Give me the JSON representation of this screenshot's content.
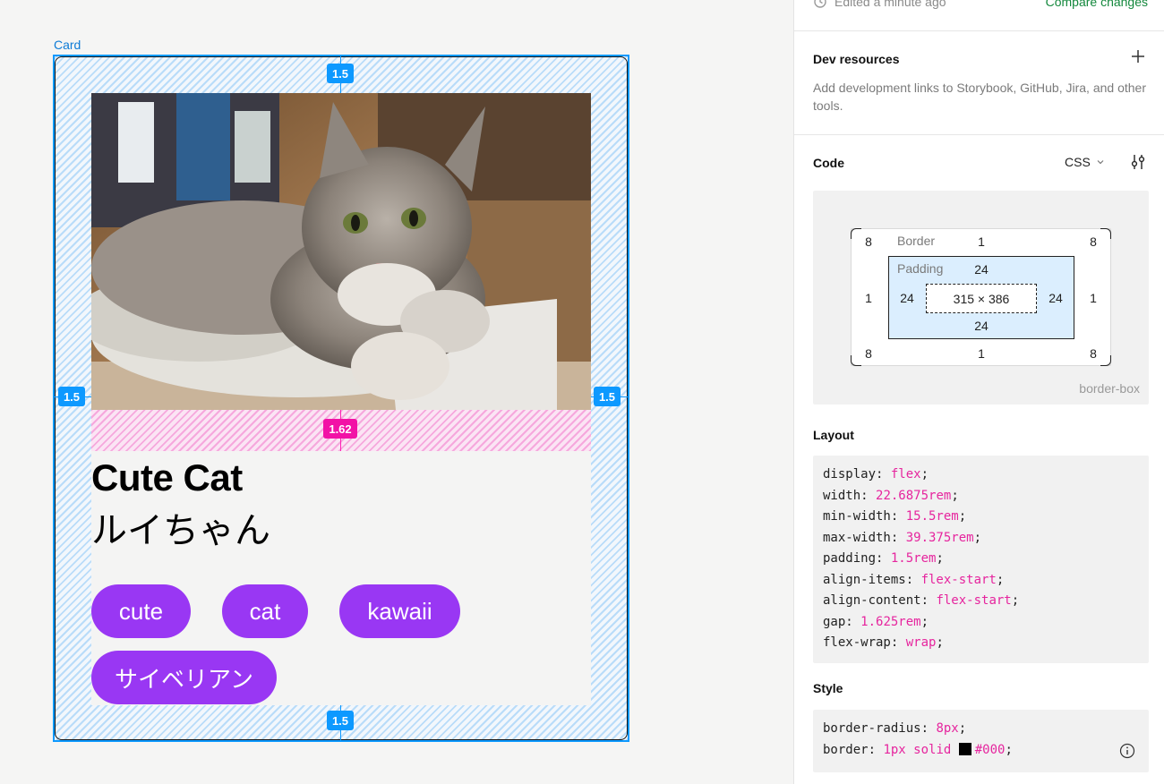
{
  "canvas": {
    "frame_label": "Card",
    "card": {
      "title": "Cute Cat",
      "subtitle": "ルイちゃん",
      "tags": [
        "cute",
        "cat",
        "kawaii",
        "サイベリアン"
      ]
    },
    "measurements": {
      "padding_top": "1.5",
      "padding_left": "1.5",
      "padding_right": "1.5",
      "padding_bottom": "1.5",
      "gap": "1.62"
    }
  },
  "panel": {
    "history": {
      "edited_text": "Edited a minute ago",
      "compare_link": "Compare changes"
    },
    "dev_resources": {
      "title": "Dev resources",
      "description": "Add development links to Storybook, GitHub, Jira, and other tools."
    },
    "code": {
      "title": "Code",
      "language": "CSS",
      "box_model": {
        "border_label": "Border",
        "padding_label": "Padding",
        "radius_tl": "8",
        "radius_tr": "8",
        "radius_bl": "8",
        "radius_br": "8",
        "border_top": "1",
        "border_bottom": "1",
        "border_left": "1",
        "border_right": "1",
        "padding_top": "24",
        "padding_bottom": "24",
        "padding_left": "24",
        "padding_right": "24",
        "content_size": "315 × 386",
        "box_sizing": "border-box"
      }
    },
    "layout": {
      "title": "Layout",
      "lines": [
        {
          "prop": "display",
          "value": "flex"
        },
        {
          "prop": "width",
          "value": "22.6875rem"
        },
        {
          "prop": "min-width",
          "value": "15.5rem"
        },
        {
          "prop": "max-width",
          "value": "39.375rem"
        },
        {
          "prop": "padding",
          "value": "1.5rem"
        },
        {
          "prop": "align-items",
          "value": "flex-start"
        },
        {
          "prop": "align-content",
          "value": "flex-start"
        },
        {
          "prop": "gap",
          "value": "1.625rem"
        },
        {
          "prop": "flex-wrap",
          "value": "wrap"
        }
      ]
    },
    "style": {
      "title": "Style",
      "lines": [
        {
          "prop": "border-radius",
          "value": "8px"
        },
        {
          "prop": "border",
          "value": "1px solid",
          "color": "#000"
        }
      ]
    }
  },
  "colors": {
    "selection": "#0d99ff",
    "gap_highlight": "#f212a6",
    "tag_bg": "#9937f3",
    "css_value": "#e6259e",
    "compare_link": "#14883d"
  },
  "icons": [
    "history-icon",
    "plus-icon",
    "chevron-down-icon",
    "settings-sliders-icon",
    "info-icon",
    "cat-photo"
  ]
}
